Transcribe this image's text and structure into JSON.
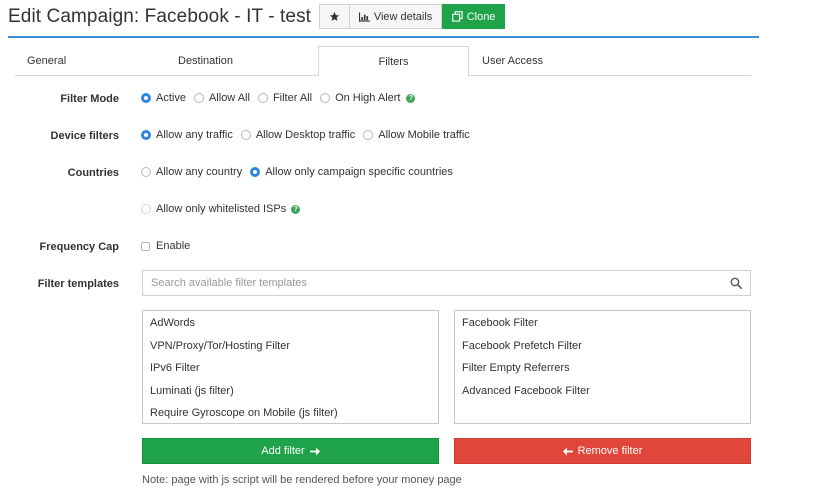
{
  "header": {
    "title": "Edit Campaign: Facebook - IT - test",
    "view_details_label": "View details",
    "clone_label": "Clone"
  },
  "tabs": [
    {
      "label": "General",
      "active": false
    },
    {
      "label": "Destination",
      "active": false
    },
    {
      "label": "Filters",
      "active": true
    },
    {
      "label": "User Access",
      "active": false
    }
  ],
  "form": {
    "filter_mode": {
      "label": "Filter Mode",
      "options": [
        "Active",
        "Allow All",
        "Filter All",
        "On High Alert"
      ],
      "selected": "Active"
    },
    "device_filters": {
      "label": "Device filters",
      "options": [
        "Allow any traffic",
        "Allow Desktop traffic",
        "Allow Mobile traffic"
      ],
      "selected": "Allow any traffic"
    },
    "countries": {
      "label": "Countries",
      "options": [
        "Allow any country",
        "Allow only campaign specific countries"
      ],
      "selected": "Allow only campaign specific countries"
    },
    "isp": {
      "label": "Allow only whitelisted ISPs",
      "checked": false
    },
    "frequency_cap": {
      "label": "Frequency Cap",
      "enable_label": "Enable",
      "checked": false
    },
    "filter_templates": {
      "label": "Filter templates",
      "search_placeholder": "Search available filter templates",
      "available": [
        "AdWords",
        "VPN/Proxy/Tor/Hosting Filter",
        "IPv6 Filter",
        "Luminati (js filter)",
        "Require Gyroscope on Mobile (js filter)"
      ],
      "selected": [
        "Facebook Filter",
        "Facebook Prefetch Filter",
        "Filter Empty Referrers",
        "Advanced Facebook Filter"
      ]
    }
  },
  "actions": {
    "add_label": "Add filter",
    "remove_label": "Remove filter"
  },
  "note": "Note: page with js script will be rendered before your money page",
  "colors": {
    "accent_blue": "#2f86e0",
    "success_green": "#1ea34a",
    "danger_red": "#e0473a"
  }
}
